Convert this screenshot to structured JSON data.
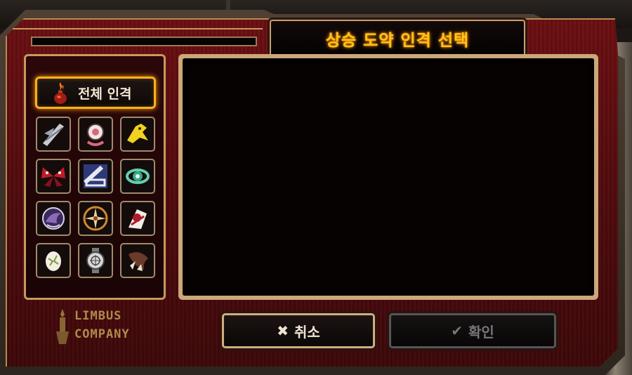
{
  "dialog": {
    "title": "상승 도약 인격 선택",
    "progress_fraction": 0
  },
  "filter": {
    "all_label": "전체 인격",
    "all_icon": "flame-vial-icon",
    "sinners": [
      {
        "icon": "yisang-feather-icon"
      },
      {
        "icon": "faust-clock-icon"
      },
      {
        "icon": "donquixote-horse-icon"
      },
      {
        "icon": "ryoshu-butterfly-icon"
      },
      {
        "icon": "meursault-shackle-icon"
      },
      {
        "icon": "honglu-lantern-icon"
      },
      {
        "icon": "heathcliff-raven-icon"
      },
      {
        "icon": "ishmael-compass-icon"
      },
      {
        "icon": "rodion-rose-icon"
      },
      {
        "icon": "sinclair-egg-icon"
      },
      {
        "icon": "outis-watch-icon"
      },
      {
        "icon": "gregor-bug-icon"
      }
    ]
  },
  "logo": {
    "line1": "LIMBUS",
    "line2": "COMPANY"
  },
  "buttons": {
    "cancel_label": "취소",
    "cancel_icon": "x-icon",
    "confirm_label": "확인",
    "confirm_icon": "check-icon"
  },
  "colors": {
    "accent_gold": "#ffc21c",
    "frame_red": "#6b0f12",
    "border_gold": "#c59a5e",
    "disabled_gray": "#777777"
  }
}
